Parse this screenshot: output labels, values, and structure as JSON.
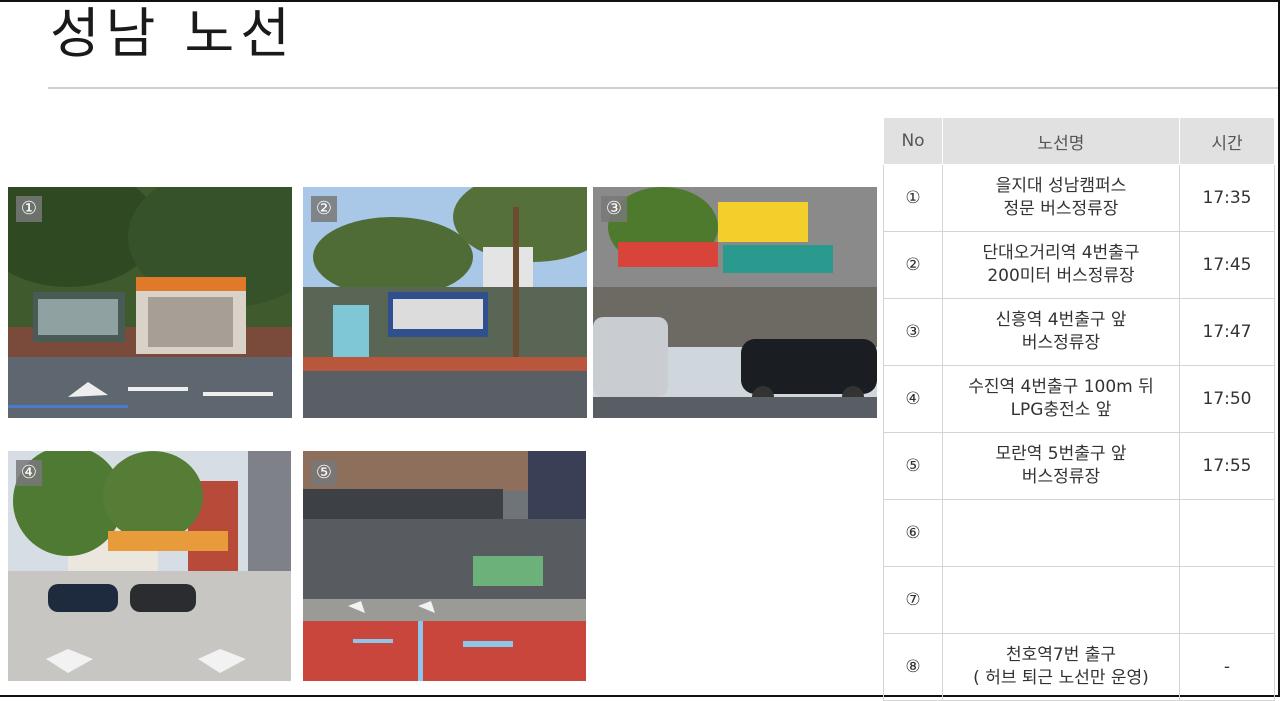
{
  "page": {
    "title": "성남 노선"
  },
  "photos": [
    {
      "label": "①"
    },
    {
      "label": "②"
    },
    {
      "label": "③"
    },
    {
      "label": "④"
    },
    {
      "label": "⑤"
    }
  ],
  "table": {
    "headers": {
      "no": "No",
      "name": "노선명",
      "time": "시간"
    },
    "rows": [
      {
        "no": "①",
        "line1": "을지대 성남캠퍼스",
        "line2": "정문 버스정류장",
        "time": "17:35"
      },
      {
        "no": "②",
        "line1": "단대오거리역 4번출구",
        "line2": "200미터 버스정류장",
        "time": "17:45"
      },
      {
        "no": "③",
        "line1": "신흥역 4번출구 앞",
        "line2": "버스정류장",
        "time": "17:47"
      },
      {
        "no": "④",
        "line1": "수진역 4번출구 100m 뒤",
        "line2": "LPG충전소 앞",
        "time": "17:50"
      },
      {
        "no": "⑤",
        "line1": "모란역 5번출구 앞",
        "line2": "버스정류장",
        "time": "17:55"
      },
      {
        "no": "⑥",
        "line1": "",
        "line2": "",
        "time": ""
      },
      {
        "no": "⑦",
        "line1": "",
        "line2": "",
        "time": ""
      },
      {
        "no": "⑧",
        "line1": "천호역7번 출구",
        "line2": "( 허브 퇴근 노선만 운영)",
        "time": "-"
      }
    ]
  }
}
